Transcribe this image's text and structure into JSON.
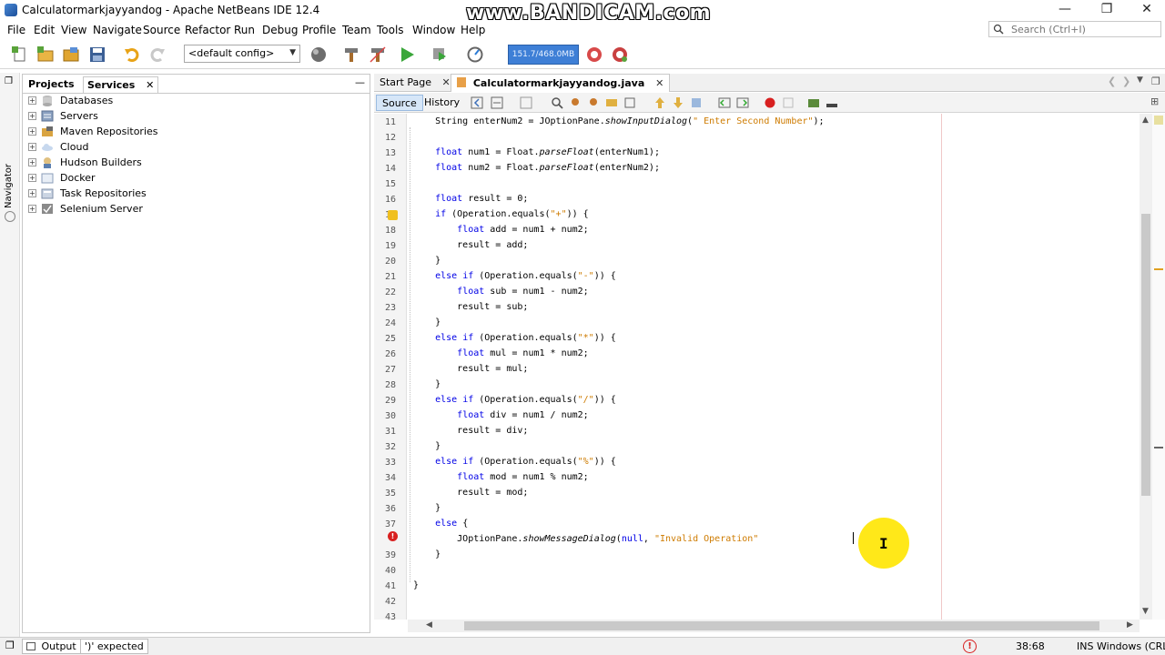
{
  "window": {
    "title": "Calculatormarkjayyandog - Apache NetBeans IDE 12.4",
    "watermark": "www.BANDICAM.com",
    "minimize_icon": "minimize-icon",
    "maximize_icon": "restore-icon",
    "close_icon": "close-icon"
  },
  "menu": [
    "File",
    "Edit",
    "View",
    "Navigate",
    "Source",
    "Refactor",
    "Run",
    "Debug",
    "Profile",
    "Team",
    "Tools",
    "Window",
    "Help"
  ],
  "search": {
    "placeholder": "Search (Ctrl+I)"
  },
  "toolbar": {
    "config": "<default config>",
    "memory": "151.7/468.0MB"
  },
  "navigator": {
    "label": "Navigator"
  },
  "left_panel": {
    "tabs": [
      "Projects",
      "Services"
    ],
    "active_tab": "Services",
    "minimize": "—",
    "tree": [
      {
        "label": "Databases",
        "icon": "database-icon"
      },
      {
        "label": "Servers",
        "icon": "server-icon"
      },
      {
        "label": "Maven Repositories",
        "icon": "maven-icon"
      },
      {
        "label": "Cloud",
        "icon": "cloud-icon"
      },
      {
        "label": "Hudson Builders",
        "icon": "hudson-icon"
      },
      {
        "label": "Docker",
        "icon": "docker-icon"
      },
      {
        "label": "Task Repositories",
        "icon": "task-repo-icon"
      },
      {
        "label": "Selenium Server",
        "icon": "selenium-icon"
      }
    ]
  },
  "editor": {
    "tabs": [
      {
        "label": "Start Page",
        "active": false
      },
      {
        "label": "Calculatormarkjayyandog.java",
        "active": true
      }
    ],
    "subtabs": [
      "Source",
      "History"
    ],
    "lines": [
      {
        "n": "11",
        "html": "    String enterNum2 = JOptionPane.<span class=\"it\">showInputDialog</span>(<span class=\"str\">\" Enter Second Number\"</span>);"
      },
      {
        "n": "12",
        "html": ""
      },
      {
        "n": "13",
        "html": "    <span class=\"kw\">float</span> num1 = Float.<span class=\"it\">parseFloat</span>(enterNum1);"
      },
      {
        "n": "14",
        "html": "    <span class=\"kw\">float</span> num2 = Float.<span class=\"it\">parseFloat</span>(enterNum2);"
      },
      {
        "n": "15",
        "html": ""
      },
      {
        "n": "16",
        "html": "    <span class=\"kw\">float</span> result = 0;"
      },
      {
        "n": "17",
        "html": "    <span class=\"kw\">if</span> (Operation.equals(<span class=\"str\">\"+\"</span>)) {"
      },
      {
        "n": "18",
        "html": "        <span class=\"kw\">float</span> add = num1 + num2;"
      },
      {
        "n": "19",
        "html": "        result = add;"
      },
      {
        "n": "20",
        "html": "    }"
      },
      {
        "n": "21",
        "html": "    <span class=\"kw\">else if</span> (Operation.equals(<span class=\"str\">\"-\"</span>)) {"
      },
      {
        "n": "22",
        "html": "        <span class=\"kw\">float</span> sub = num1 - num2;"
      },
      {
        "n": "23",
        "html": "        result = sub;"
      },
      {
        "n": "24",
        "html": "    }"
      },
      {
        "n": "25",
        "html": "    <span class=\"kw\">else if</span> (Operation.equals(<span class=\"str\">\"*\"</span>)) {"
      },
      {
        "n": "26",
        "html": "        <span class=\"kw\">float</span> mul = num1 * num2;"
      },
      {
        "n": "27",
        "html": "        result = mul;"
      },
      {
        "n": "28",
        "html": "    }"
      },
      {
        "n": "29",
        "html": "    <span class=\"kw\">else if</span> (Operation.equals(<span class=\"str\">\"/\"</span>)) {"
      },
      {
        "n": "30",
        "html": "        <span class=\"kw\">float</span> div = num1 / num2;"
      },
      {
        "n": "31",
        "html": "        result = div;"
      },
      {
        "n": "32",
        "html": "    }"
      },
      {
        "n": "33",
        "html": "    <span class=\"kw\">else if</span> (Operation.equals(<span class=\"str\">\"%\"</span>)) {"
      },
      {
        "n": "34",
        "html": "        <span class=\"kw\">float</span> mod = num1 % num2;"
      },
      {
        "n": "35",
        "html": "        result = mod;"
      },
      {
        "n": "36",
        "html": "    }"
      },
      {
        "n": "37",
        "html": "    <span class=\"kw\">else</span> {"
      },
      {
        "n": "",
        "html": "        JOptionPane.<span class=\"it\">showMessageDialog</span>(<span class=\"kw\">null</span>, <span class=\"str\">\"Invalid Operation\"</span>"
      },
      {
        "n": "39",
        "html": "    }"
      },
      {
        "n": "40",
        "html": ""
      },
      {
        "n": "41",
        "html": "}"
      },
      {
        "n": "42",
        "html": ""
      },
      {
        "n": "43",
        "html": ""
      }
    ]
  },
  "status": {
    "output": "Output",
    "message": "')' expected",
    "position": "38:68",
    "mode": "INS",
    "line_ending": "Windows (CRLF)"
  },
  "colors": {
    "keyword": "#0000e6",
    "string": "#ce7b00",
    "error": "#d82020",
    "highlight": "#ffe600"
  }
}
